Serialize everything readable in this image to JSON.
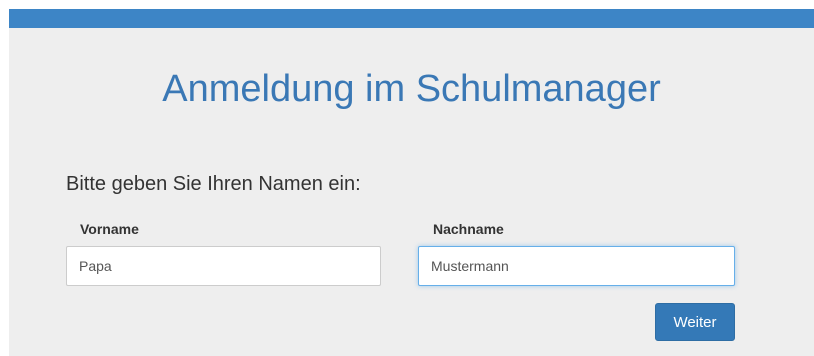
{
  "header": {
    "bar_color": "#3d85c6"
  },
  "main": {
    "title": "Anmeldung im Schulmanager",
    "prompt": "Bitte geben Sie Ihren Namen ein:",
    "fields": {
      "vorname": {
        "label": "Vorname",
        "value": "Papa"
      },
      "nachname": {
        "label": "Nachname",
        "value": "Mustermann",
        "focused": true
      }
    },
    "submit_label": "Weiter",
    "accent_color": "#3479b7"
  }
}
